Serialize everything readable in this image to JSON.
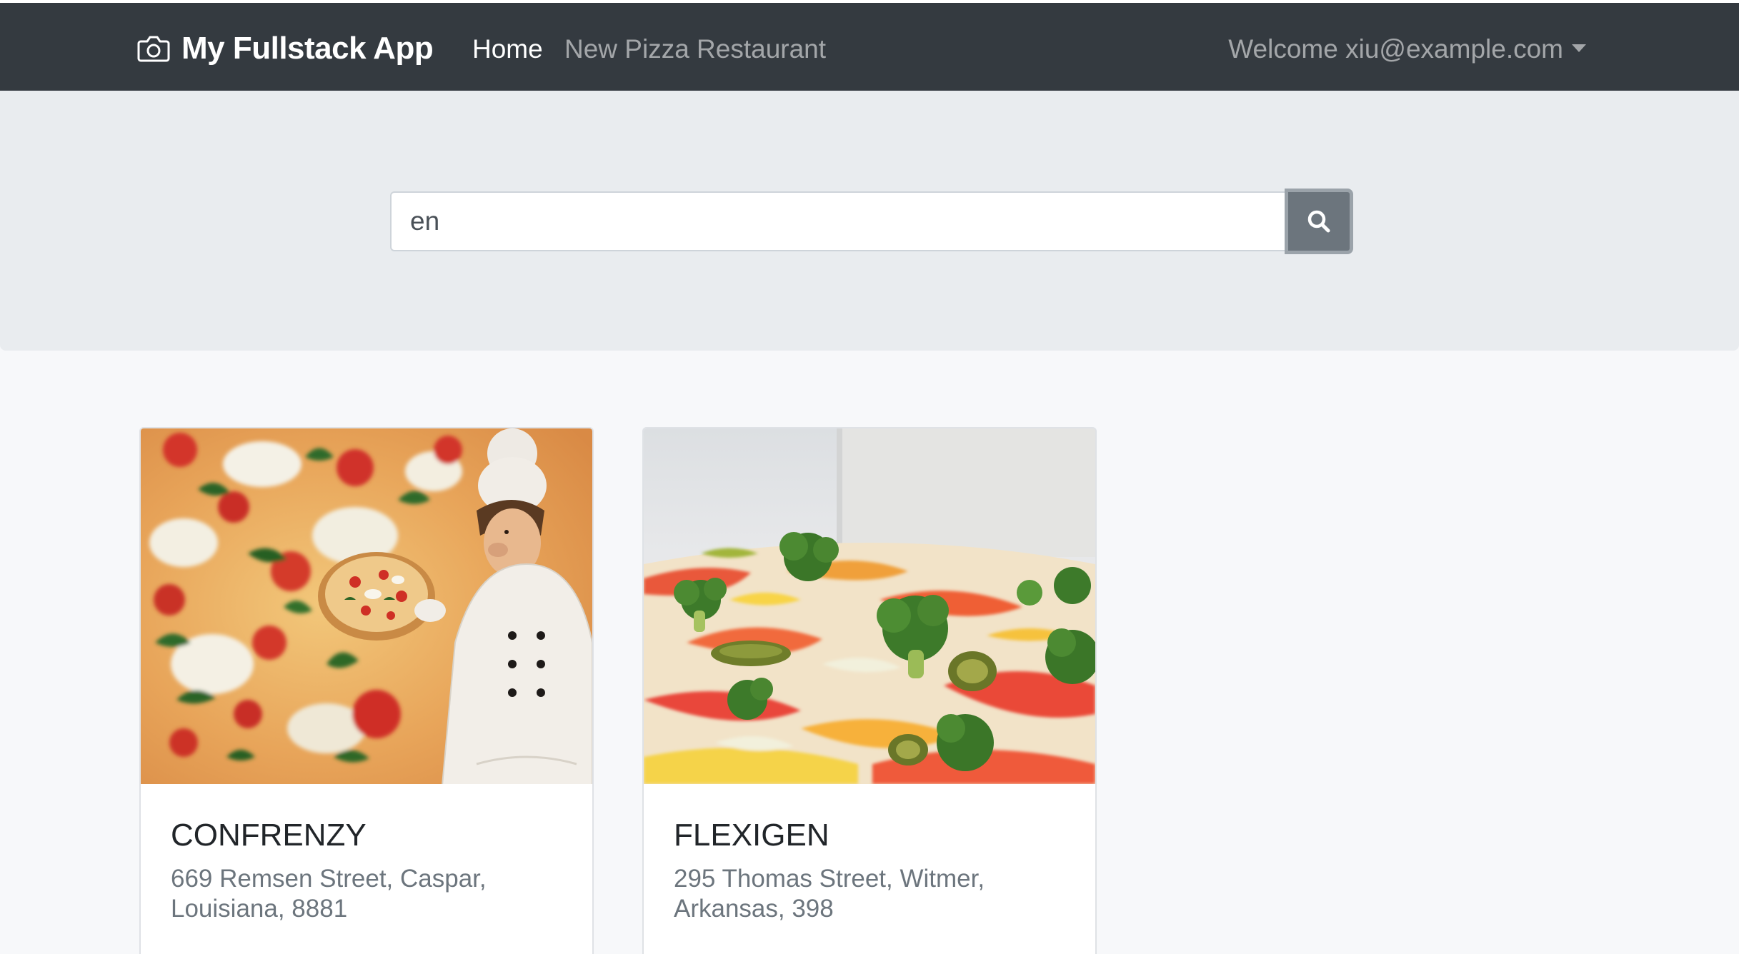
{
  "navbar": {
    "brand": "My Fullstack App",
    "brand_icon": "camera-icon",
    "links": [
      {
        "label": "Home",
        "active": true
      },
      {
        "label": "New Pizza Restaurant",
        "active": false
      }
    ],
    "user_menu_label": "Welcome xiu@example.com",
    "dropdown_icon": "caret-down-icon"
  },
  "search": {
    "value": "en",
    "button_icon": "search-icon"
  },
  "cards": [
    {
      "title": "CONFRENZY",
      "address": "669 Remsen Street, Caspar, Louisiana, 8881",
      "image": "pizza-chef-image"
    },
    {
      "title": "FLEXIGEN",
      "address": "295 Thomas Street, Witmer, Arkansas, 398",
      "image": "vegetable-pizza-image"
    }
  ],
  "colors": {
    "navbar_bg": "#343a40",
    "jumbotron_bg": "#e9ecef",
    "button_bg": "#6c757d",
    "page_bg": "#f7f8fa"
  }
}
